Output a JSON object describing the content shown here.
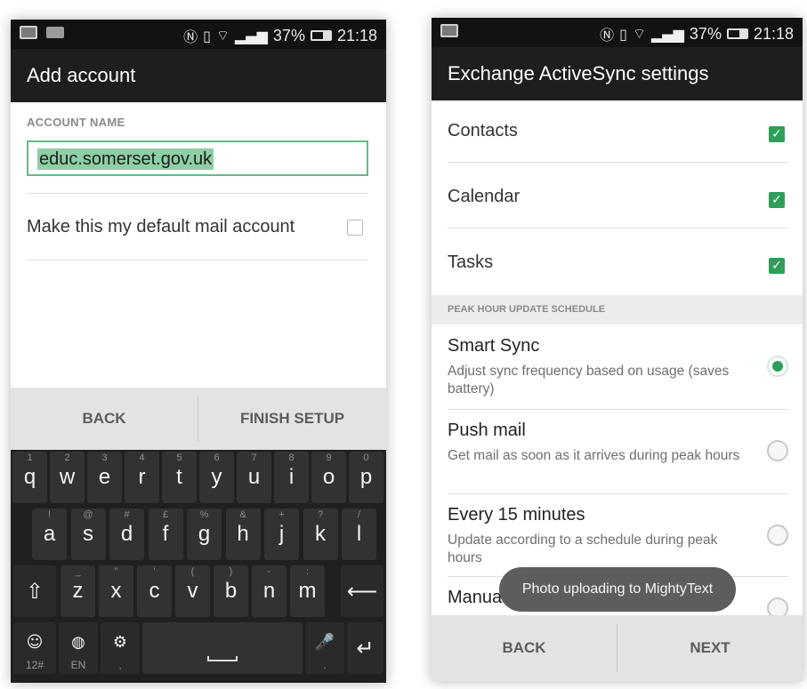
{
  "left": {
    "status": {
      "signal_percent": "37%",
      "time": "21:18"
    },
    "title": "Add account",
    "account_name_label": "ACCOUNT NAME",
    "account_name_value": "educ.somerset.gov.uk",
    "default_mail_label": "Make this my default mail account",
    "buttons": {
      "back": "BACK",
      "finish": "FINISH SETUP"
    },
    "keyboard": {
      "row1": [
        {
          "k": "q",
          "h": "1"
        },
        {
          "k": "w",
          "h": "2"
        },
        {
          "k": "e",
          "h": "3"
        },
        {
          "k": "r",
          "h": "4"
        },
        {
          "k": "t",
          "h": "5"
        },
        {
          "k": "y",
          "h": "6"
        },
        {
          "k": "u",
          "h": "7"
        },
        {
          "k": "i",
          "h": "8"
        },
        {
          "k": "o",
          "h": "9"
        },
        {
          "k": "p",
          "h": "0"
        }
      ],
      "row2": [
        {
          "k": "a",
          "h": "!"
        },
        {
          "k": "s",
          "h": "@"
        },
        {
          "k": "d",
          "h": "#"
        },
        {
          "k": "f",
          "h": "£"
        },
        {
          "k": "g",
          "h": "%"
        },
        {
          "k": "h",
          "h": "&"
        },
        {
          "k": "j",
          "h": "+"
        },
        {
          "k": "k",
          "h": "?"
        },
        {
          "k": "l",
          "h": "/"
        }
      ],
      "row3": [
        {
          "k": "z",
          "h": "_"
        },
        {
          "k": "x",
          "h": "\""
        },
        {
          "k": "c",
          "h": "'"
        },
        {
          "k": "v",
          "h": "("
        },
        {
          "k": "b",
          "h": ")"
        },
        {
          "k": "n",
          "h": "-"
        },
        {
          "k": "m",
          "h": ":"
        }
      ],
      "sym_label": "12#",
      "lang_label": "EN",
      "comma_label": ",",
      "period_label": "."
    }
  },
  "right": {
    "status": {
      "signal_percent": "37%",
      "time": "21:18"
    },
    "title": "Exchange ActiveSync settings",
    "sync_items": [
      "Contacts",
      "Calendar",
      "Tasks"
    ],
    "section_header": "PEAK HOUR UPDATE SCHEDULE",
    "options": [
      {
        "title": "Smart Sync",
        "desc": "Adjust sync frequency based on usage (saves battery)",
        "selected": true
      },
      {
        "title": "Push mail",
        "desc": "Get mail as soon as it arrives during peak hours",
        "selected": false
      },
      {
        "title": "Every 15 minutes",
        "desc": "Update according to a schedule during peak hours",
        "selected": false
      },
      {
        "title": "Manually",
        "desc": "",
        "selected": false
      }
    ],
    "toast": "Photo uploading to MightyText",
    "buttons": {
      "back": "BACK",
      "next": "NEXT"
    }
  },
  "colors": {
    "accent": "#2e9e5b",
    "appbar": "#1e1e1e",
    "statusbar": "#121212"
  },
  "icons": [
    "image-icon",
    "keyboard-icon",
    "nfc-icon",
    "vibrate-icon",
    "wifi-icon",
    "signal-icon",
    "battery-icon",
    "shift-icon",
    "backspace-icon",
    "emoji-icon",
    "globe-icon",
    "settings-icon",
    "mic-icon",
    "enter-icon",
    "space-icon"
  ]
}
